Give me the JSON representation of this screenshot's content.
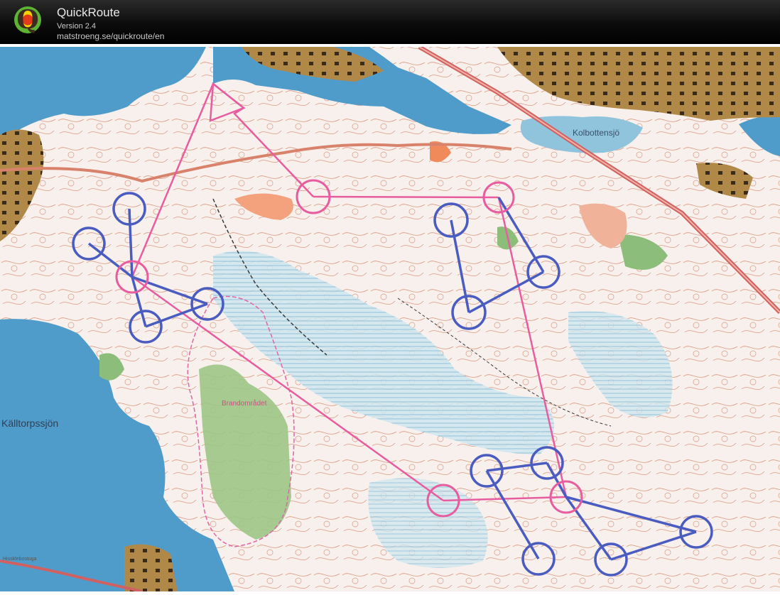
{
  "app": {
    "name": "QuickRoute",
    "version": "Version 2.4",
    "url": "matstroeng.se/quickroute/en",
    "logo_letter": "Q"
  },
  "map": {
    "place_labels": {
      "kolbottensjo": "Kolbottensjö",
      "kalltorpssjon": "Källtorpssjön",
      "brandomradet": "Brandområdet",
      "small_label": "Hissklebostuga"
    },
    "colors": {
      "water": "#4f9ccb",
      "open_land": "#f7f2ee",
      "settlement": "#a77d3f",
      "marsh": "#a9d4e0",
      "green": "#8dbd7a",
      "contour": "#d98b6f",
      "course_pink": "#e75d9f",
      "course_blue": "#4a5cc0"
    }
  }
}
